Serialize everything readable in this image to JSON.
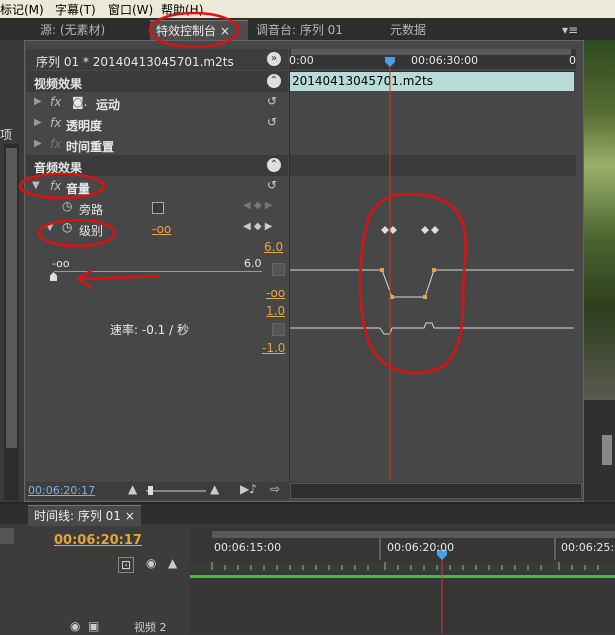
{
  "menu": {
    "items": [
      "标记(M)",
      "字幕(T)",
      "窗口(W)",
      "帮助(H)"
    ]
  },
  "tabs": [
    {
      "label": "源: (无素材)",
      "active": false
    },
    {
      "label": "特效控制台",
      "active": true,
      "close": "×"
    },
    {
      "label": "调音台: 序列 01",
      "active": false
    },
    {
      "label": "元数据",
      "active": false
    }
  ],
  "tab_menu_glyph": "▾≡",
  "left_edge_text": "项",
  "effect_controls": {
    "sequence_label": "序列 01 * 20140413045701.m2ts",
    "ruler_start": "0:00",
    "ruler_mid": "00:06:30:00",
    "ruler_end": "0",
    "clip_label": "20140413045701.m2ts",
    "video_effects_title": "视频效果",
    "motion_label": "运动",
    "opacity_label": "透明度",
    "time_remap_label": "时间重置",
    "audio_effects_title": "音频效果",
    "volume_label": "音量",
    "bypass_label": "旁路",
    "level_label": "级别",
    "level_value": "-oo",
    "level_max_top": "6.0",
    "level_min": "-oo",
    "slider_min": "-oo",
    "slider_max": "6.0",
    "velocity_top": "1.0",
    "velocity_label": "速率: -0.1 / 秒",
    "velocity_bottom": "-1.0",
    "timecode": "00:06:20:17"
  },
  "timeline": {
    "tab_label": "时间线: 序列 01",
    "timecode": "00:06:20:17",
    "ruler_labels": [
      "00:06:15:00",
      "00:06:20:00",
      "00:06:25:0"
    ],
    "track_label": "视频 2"
  },
  "colors": {
    "accent": "#e8a53a",
    "annotation": "#e01010",
    "playhead": "#e03030",
    "clip": "#b7dcd7",
    "green_bar": "#32c832"
  }
}
